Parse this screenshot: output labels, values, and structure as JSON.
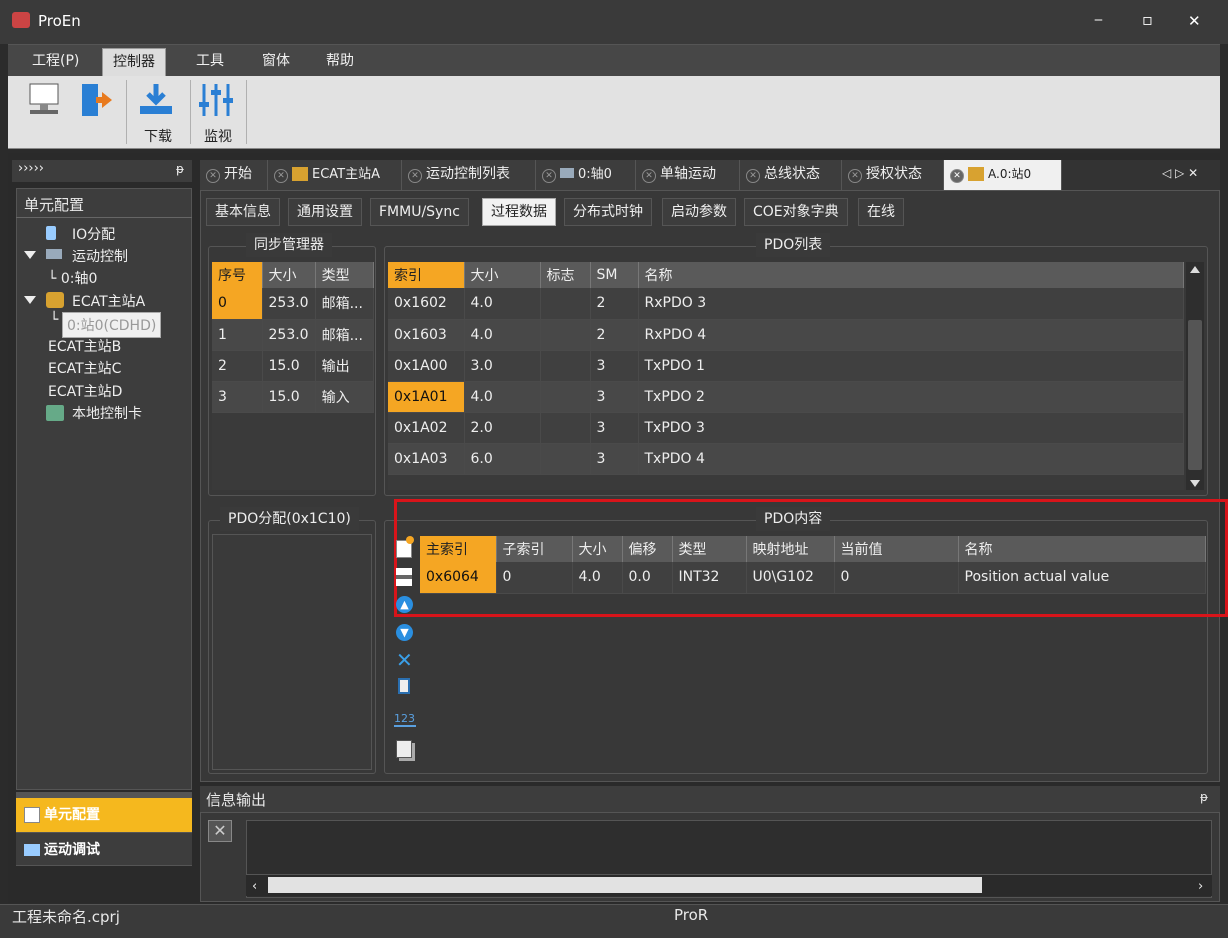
{
  "app": {
    "title": "ProEn"
  },
  "window_controls": {
    "minimize": "‒",
    "maximize": "▫",
    "close": "✕"
  },
  "menu": [
    "工程(P)",
    "控制器",
    "工具",
    "窗体",
    "帮助"
  ],
  "ribbon": {
    "download": "下载",
    "monitor": "监视"
  },
  "left": {
    "header": "›››››",
    "pin": "ᵽ",
    "title": "单元配置",
    "tree": [
      "IO分配",
      "运动控制",
      "└ 0:轴0",
      "ECAT主站A",
      "0:站0(CDHD)",
      "ECAT主站B",
      "ECAT主站C",
      "ECAT主站D",
      "本地控制卡"
    ],
    "tree_prefix": "└",
    "buttons": [
      "单元配置",
      "运动调试"
    ]
  },
  "tabs": [
    "开始",
    "ECAT主站A",
    "运动控制列表",
    "0:轴0",
    "单轴运动",
    "总线状态",
    "授权状态",
    "A.0:站0"
  ],
  "tab_nav": "◁ ▷ ✕",
  "subtabs": [
    "基本信息",
    "通用设置",
    "FMMU/Sync",
    "过程数据",
    "分布式时钟",
    "启动参数",
    "COE对象字典",
    "在线"
  ],
  "sync": {
    "legend": "同步管理器",
    "headers": [
      "序号",
      "大小",
      "类型"
    ],
    "rows": [
      [
        "0",
        "253.0",
        "邮箱..."
      ],
      [
        "1",
        "253.0",
        "邮箱..."
      ],
      [
        "2",
        "15.0",
        "输出"
      ],
      [
        "3",
        "15.0",
        "输入"
      ]
    ]
  },
  "pdo_list": {
    "legend": "PDO列表",
    "headers": [
      "索引",
      "大小",
      "标志",
      "SM",
      "名称"
    ],
    "rows": [
      [
        "0x1602",
        "4.0",
        "",
        "2",
        "RxPDO 3"
      ],
      [
        "0x1603",
        "4.0",
        "",
        "2",
        "RxPDO 4"
      ],
      [
        "0x1A00",
        "3.0",
        "",
        "3",
        "TxPDO 1"
      ],
      [
        "0x1A01",
        "4.0",
        "",
        "3",
        "TxPDO 2"
      ],
      [
        "0x1A02",
        "2.0",
        "",
        "3",
        "TxPDO 3"
      ],
      [
        "0x1A03",
        "6.0",
        "",
        "3",
        "TxPDO 4"
      ]
    ]
  },
  "pdo_assign": {
    "legend": "PDO分配(0x1C10)"
  },
  "pdo_content": {
    "legend": "PDO内容",
    "headers": [
      "主索引",
      "子索引",
      "大小",
      "偏移",
      "类型",
      "映射地址",
      "当前值",
      "名称"
    ],
    "rows": [
      [
        "0x6064",
        "0",
        "4.0",
        "0.0",
        "INT32",
        "U0\\G102",
        "0",
        "Position actual value"
      ]
    ],
    "tool_label": "123"
  },
  "output": {
    "title": "信息输出",
    "pin": "ᵽ"
  },
  "status": {
    "file": "工程未命名.cprj",
    "center": "ProR"
  }
}
